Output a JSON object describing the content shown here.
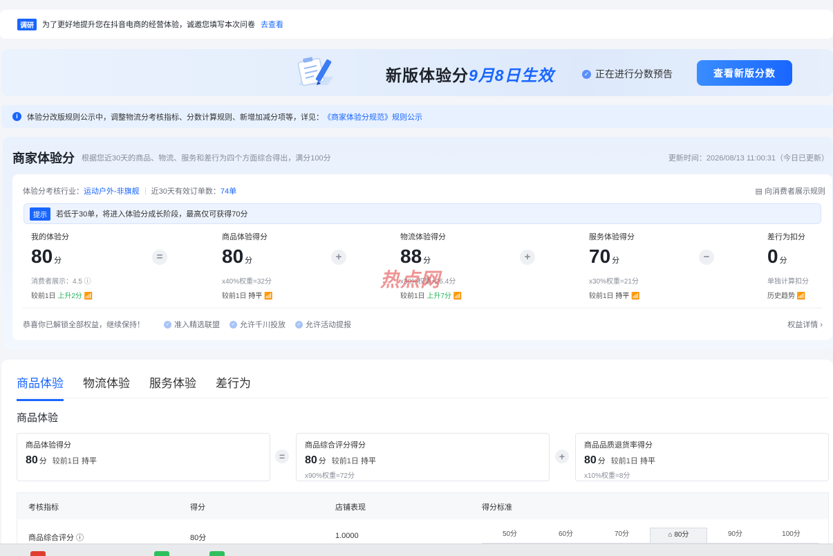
{
  "survey": {
    "tag": "调研",
    "text": "为了更好地提升您在抖音电商的经营体验，诚邀您填写本次问卷",
    "link": "去查看"
  },
  "banner": {
    "title_main": "新版体验分",
    "title_highlight": "9月8日生效",
    "status": "正在进行分数预告",
    "button": "查看新版分数"
  },
  "notice": {
    "text": "体验分改版规则公示中，调整物流分考核指标、分数计算规则、新增加减分项等，详见：",
    "link": "《商家体验分规范》规则公示"
  },
  "panel": {
    "title": "商家体验分",
    "desc": "根据您近30天的商品、物流、服务和差行为四个方面综合得出，满分100分",
    "update": "更新时间：2026/08/13 11:00:31（今日已更新）",
    "industry_label": "体验分考核行业：",
    "industry_value": "运动户外-非旗舰",
    "orders_label": "近30天有效订单数：",
    "orders_value": "74单",
    "display_rule": "向消费者展示规则",
    "tip_tag": "提示",
    "tip_text": "若低于30单，将进入体验分成长阶段，最高仅可获得70分",
    "metrics": [
      {
        "label": "我的体验分",
        "value": "80",
        "unit": "分",
        "sub": "消费者展示：4.5 ⓘ",
        "cmp_prefix": "较前1日",
        "cmp_value": "上升2分"
      },
      {
        "label": "商品体验得分",
        "value": "80",
        "unit": "分",
        "sub": "x40%权重=32分",
        "cmp_prefix": "较前1日",
        "cmp_value": "持平"
      },
      {
        "label": "物流体验得分",
        "value": "88",
        "unit": "分",
        "sub": "x30%权重=26.4分",
        "cmp_prefix": "较前1日",
        "cmp_value": "上升7分"
      },
      {
        "label": "服务体验得分",
        "value": "70",
        "unit": "分",
        "sub": "x30%权重=21分",
        "cmp_prefix": "较前1日",
        "cmp_value": "持平"
      },
      {
        "label": "差行为扣分",
        "value": "0",
        "unit": "分",
        "sub": "单独计算扣分",
        "cmp_prefix": "历史趋势",
        "cmp_value": ""
      }
    ],
    "operators": [
      "=",
      "+",
      "+",
      "−"
    ],
    "rights_text": "恭喜你已解锁全部权益，继续保持！",
    "rights": [
      "准入精选联盟",
      "允许千川投放",
      "允许活动提报"
    ],
    "rights_detail": "权益详情 ›"
  },
  "watermark": "热点网",
  "tabs": [
    "商品体验",
    "物流体验",
    "服务体验",
    "差行为"
  ],
  "section_title": "商品体验",
  "boxes": [
    {
      "label": "商品体验得分",
      "value": "80",
      "unit": "分",
      "cmp_prefix": "较前1日",
      "cmp_value": "持平",
      "weight": ""
    },
    {
      "label": "商品综合评分得分",
      "value": "80",
      "unit": "分",
      "cmp_prefix": "较前1日",
      "cmp_value": "持平",
      "weight": "x90%权重=72分"
    },
    {
      "label": "商品品质退货率得分",
      "value": "80",
      "unit": "分",
      "cmp_prefix": "较前1日",
      "cmp_value": "持平",
      "weight": "x10%权重=8分"
    }
  ],
  "box_operators": [
    "=",
    "+"
  ],
  "table": {
    "headers": [
      "考核指标",
      "得分",
      "店铺表现",
      "得分标准"
    ],
    "row": {
      "name": "商品综合评分 ⓘ",
      "score": "80分",
      "performance": "1.0000"
    },
    "scale": [
      "50分",
      "60分",
      "70分",
      "⌂ 80分",
      "90分",
      "100分"
    ],
    "scale_current_index": 3
  },
  "colors": {
    "accent": "#1966ff",
    "up": "#21b45b",
    "watermark": "#e43c3c"
  }
}
